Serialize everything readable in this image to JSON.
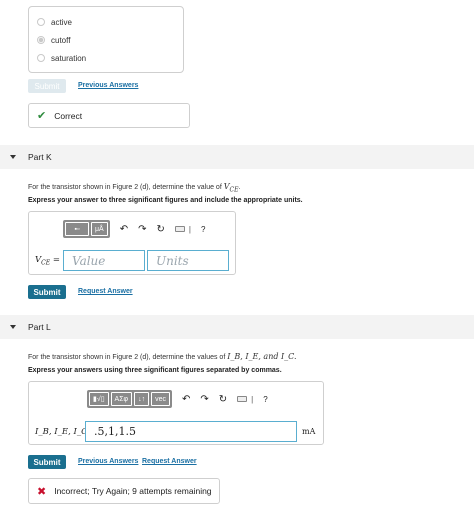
{
  "prev_part": {
    "options": [
      {
        "label": "active",
        "checked": false
      },
      {
        "label": "cutoff",
        "checked": true
      },
      {
        "label": "saturation",
        "checked": false
      }
    ],
    "submit_label": "Submit",
    "previous_answers_label": "Previous Answers",
    "feedback": "Correct"
  },
  "part_k": {
    "title": "Part K",
    "question": "For the transistor shown in Figure 2 (d), determine the value of",
    "question_var": "V",
    "question_sub": "CE",
    "instruction": "Express your answer to three significant figures and include the appropriate units.",
    "toolbar": {
      "unit_btn": "μÅ",
      "help": "?"
    },
    "var_label": "V",
    "var_sub": "CE",
    "eq": " =",
    "value_placeholder": "Value",
    "units_placeholder": "Units",
    "submit_label": "Submit",
    "request_answer_label": "Request Answer"
  },
  "part_l": {
    "title": "Part L",
    "question": "For the transistor shown in Figure 2 (d), determine the values of",
    "question_vars": "I_B, I_E, and I_C.",
    "instruction": "Express your answers using three significant figures separated by commas.",
    "toolbar": {
      "sqrt_btn": "▮√▯",
      "greek_btn": "ΑΣφ",
      "arrows_btn": "↓↑",
      "vec_btn": "vec",
      "help": "?"
    },
    "var_label": "I_B, I_E, I_C =",
    "answer_value": ".5,1,1.5",
    "unit": "mA",
    "submit_label": "Submit",
    "previous_answers_label": "Previous Answers",
    "request_answer_label": "Request Answer",
    "feedback": "Incorrect; Try Again; 9 attempts remaining"
  }
}
